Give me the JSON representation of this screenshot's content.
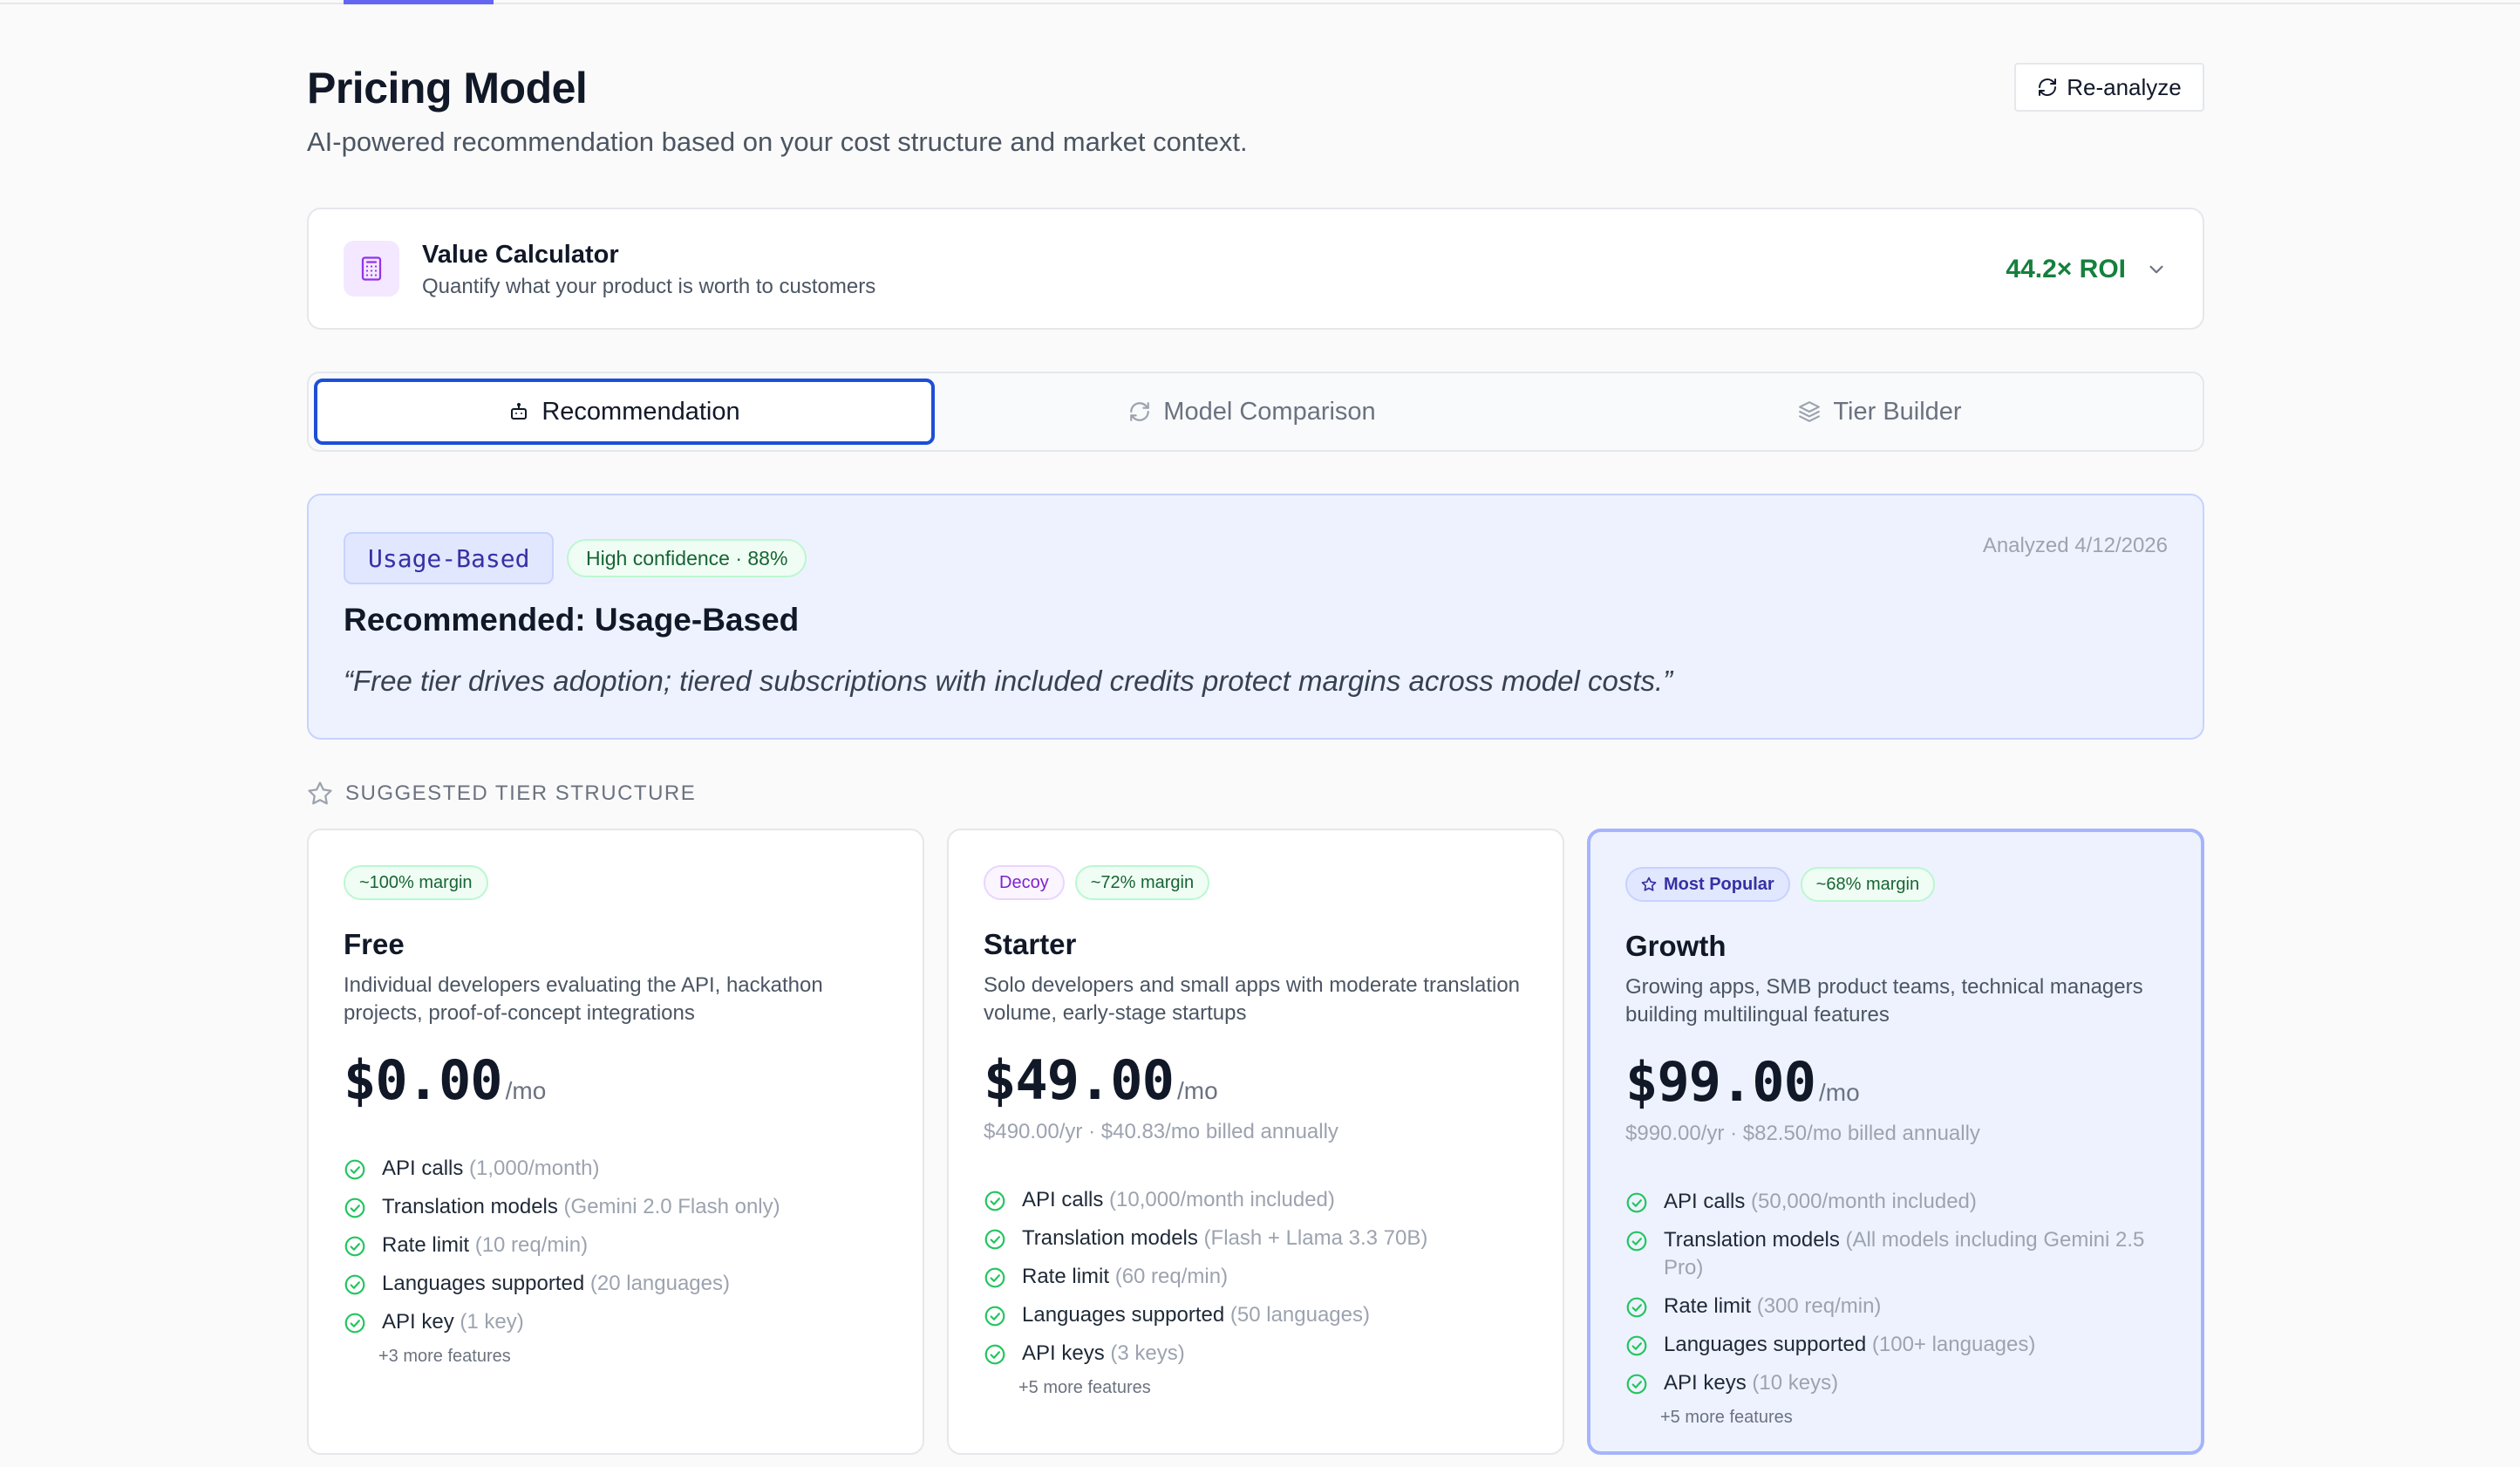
{
  "header": {
    "title": "Pricing Model",
    "subtitle": "AI-powered recommendation based on your cost structure and market context.",
    "reanalyze_label": "Re-analyze"
  },
  "value_calculator": {
    "title": "Value Calculator",
    "subtitle": "Quantify what your product is worth to customers",
    "roi": "44.2× ROI"
  },
  "tabs": [
    {
      "label": "Recommendation",
      "icon": "robot-icon",
      "active": true
    },
    {
      "label": "Model Comparison",
      "icon": "refresh-icon",
      "active": false
    },
    {
      "label": "Tier Builder",
      "icon": "layers-icon",
      "active": false
    }
  ],
  "recommendation": {
    "model_badge": "Usage-Based",
    "confidence": "High confidence · 88%",
    "analyzed": "Analyzed 4/12/2026",
    "title": "Recommended: Usage-Based",
    "quote": "“Free tier drives adoption; tiered subscriptions with included credits protect margins across model costs.”"
  },
  "tier_section_title": "SUGGESTED TIER STRUCTURE",
  "tiers": [
    {
      "badges": [
        {
          "label": "~100% margin",
          "kind": "margin"
        }
      ],
      "name": "Free",
      "description": "Individual developers evaluating the API, hackathon projects, proof-of-concept integrations",
      "price": "$0.00",
      "per": "/mo",
      "annual": "",
      "features": [
        {
          "name": "API calls",
          "detail": "(1,000/month)"
        },
        {
          "name": "Translation models",
          "detail": "(Gemini 2.0 Flash only)"
        },
        {
          "name": "Rate limit",
          "detail": "(10 req/min)"
        },
        {
          "name": "Languages supported",
          "detail": "(20 languages)"
        },
        {
          "name": "API key",
          "detail": "(1 key)"
        }
      ],
      "more": "+3 more features"
    },
    {
      "badges": [
        {
          "label": "Decoy",
          "kind": "decoy"
        },
        {
          "label": "~72% margin",
          "kind": "margin"
        }
      ],
      "name": "Starter",
      "description": "Solo developers and small apps with moderate translation volume, early-stage startups",
      "price": "$49.00",
      "per": "/mo",
      "annual": "$490.00/yr · $40.83/mo billed annually",
      "features": [
        {
          "name": "API calls",
          "detail": "(10,000/month included)"
        },
        {
          "name": "Translation models",
          "detail": "(Flash + Llama 3.3 70B)"
        },
        {
          "name": "Rate limit",
          "detail": "(60 req/min)"
        },
        {
          "name": "Languages supported",
          "detail": "(50 languages)"
        },
        {
          "name": "API keys",
          "detail": "(3 keys)"
        }
      ],
      "more": "+5 more features"
    },
    {
      "badges": [
        {
          "label": "Most Popular",
          "kind": "popular"
        },
        {
          "label": "~68% margin",
          "kind": "margin"
        }
      ],
      "name": "Growth",
      "description": "Growing apps, SMB product teams, technical managers building multilingual features",
      "price": "$99.00",
      "per": "/mo",
      "annual": "$990.00/yr · $82.50/mo billed annually",
      "features": [
        {
          "name": "API calls",
          "detail": "(50,000/month included)"
        },
        {
          "name": "Translation models",
          "detail": "(All models including Gemini 2.5 Pro)"
        },
        {
          "name": "Rate limit",
          "detail": "(300 req/min)"
        },
        {
          "name": "Languages supported",
          "detail": "(100+ languages)"
        },
        {
          "name": "API keys",
          "detail": "(10 keys)"
        }
      ],
      "more": "+5 more features"
    }
  ],
  "colors": {
    "accent": "#6366f1",
    "active_tab_border": "#1d4ed8",
    "success": "#15803d",
    "recommendation_bg": "#eef2ff"
  }
}
